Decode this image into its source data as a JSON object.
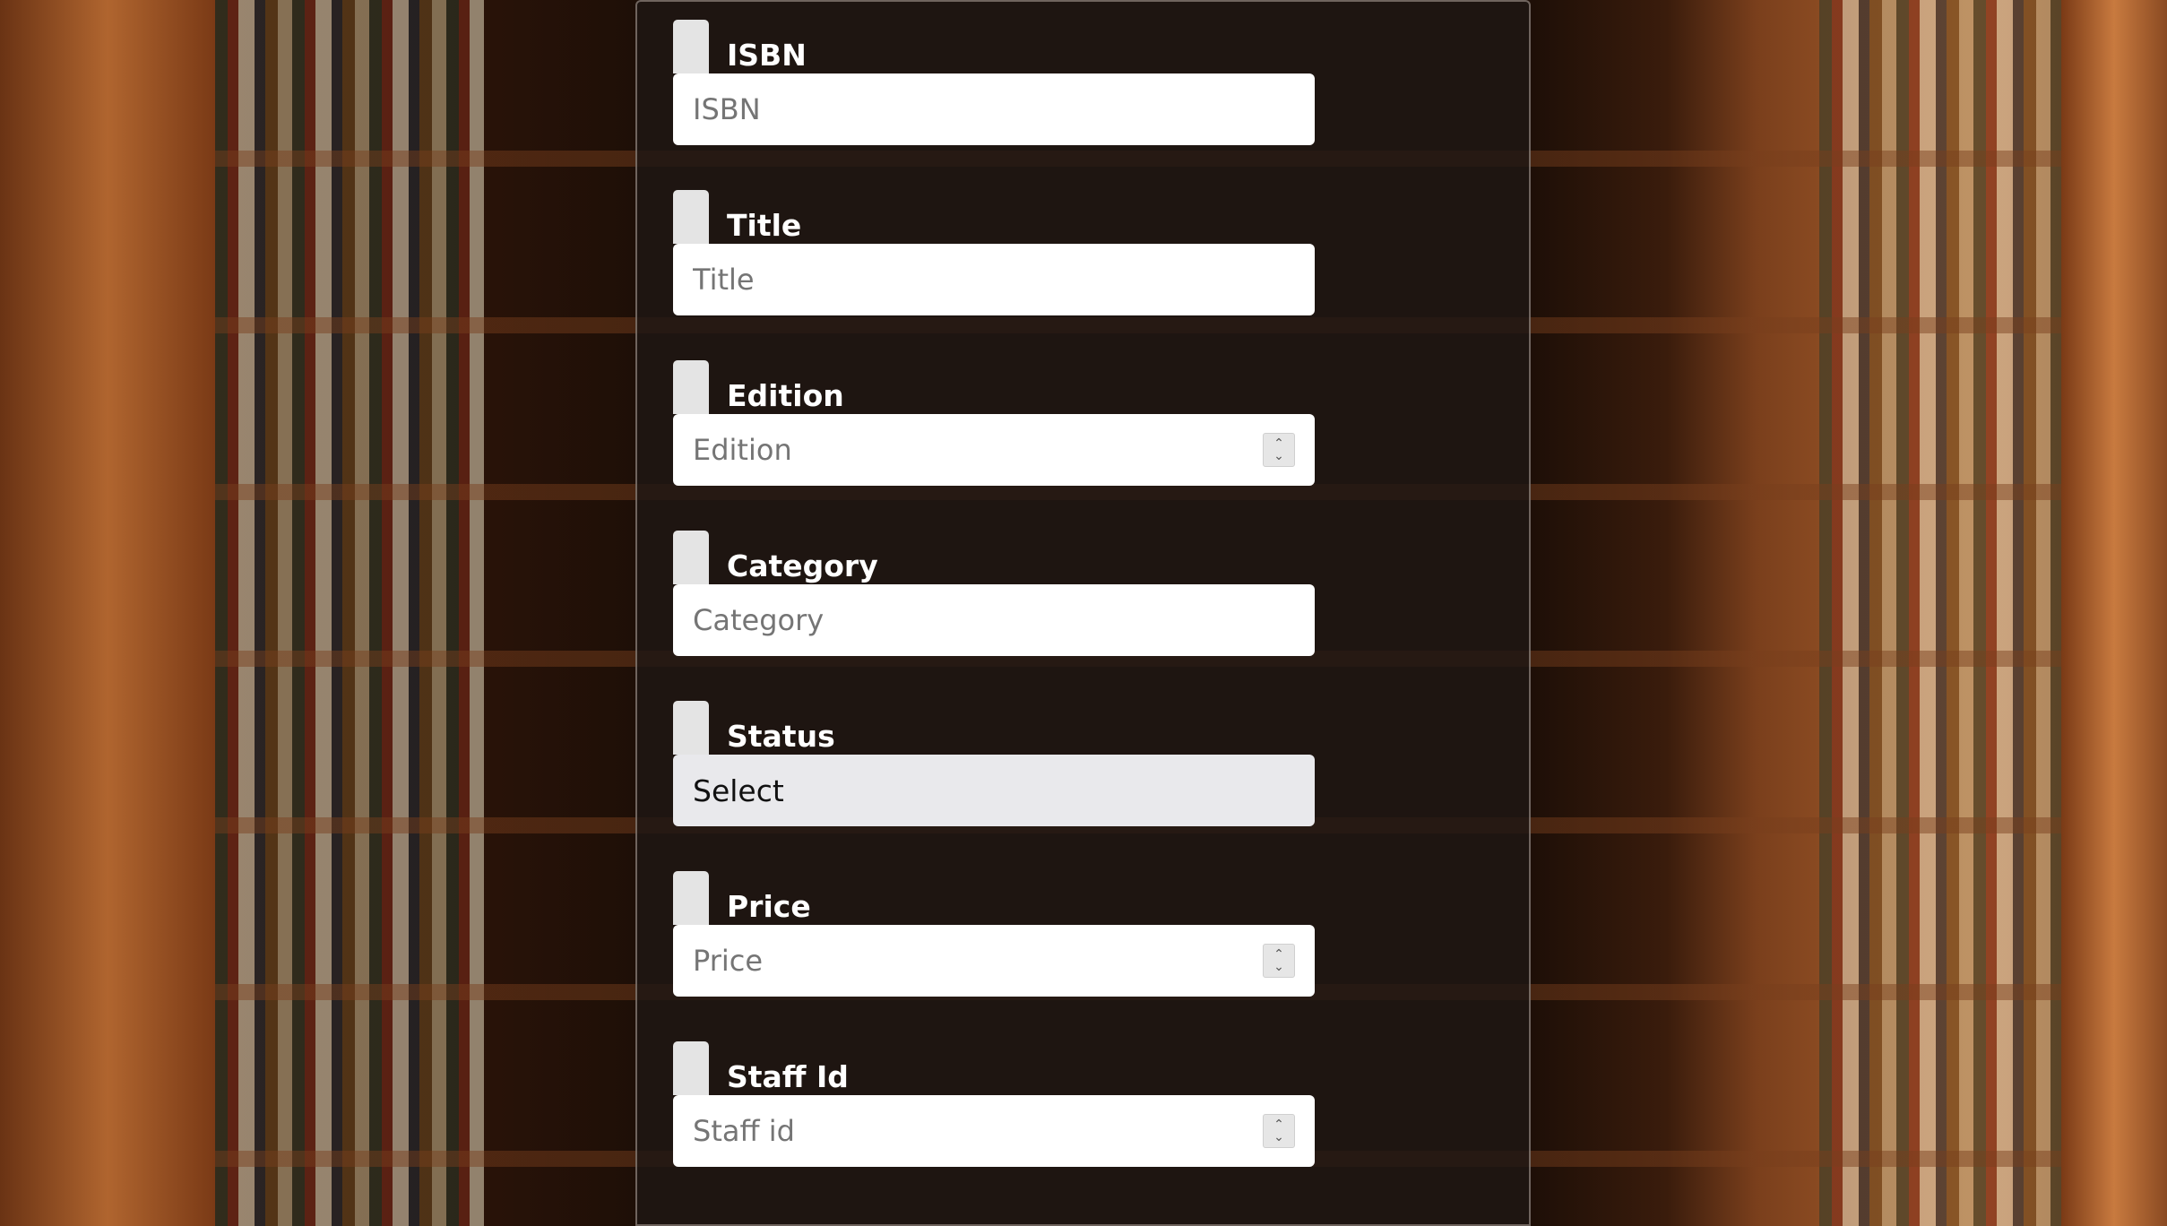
{
  "form": {
    "fields": [
      {
        "label": "ISBN",
        "placeholder": "ISBN",
        "type": "text"
      },
      {
        "label": "Title",
        "placeholder": "Title",
        "type": "text"
      },
      {
        "label": "Edition",
        "placeholder": "Edition",
        "type": "number"
      },
      {
        "label": "Category",
        "placeholder": "Category",
        "type": "text"
      },
      {
        "label": "Status",
        "selected": "Select",
        "type": "select"
      },
      {
        "label": "Price",
        "placeholder": "Price",
        "type": "number"
      },
      {
        "label": "Staff Id",
        "placeholder": "Staff id",
        "type": "number"
      }
    ]
  },
  "colors": {
    "panel_background": "#1e1614",
    "label_text": "#ffffff",
    "input_background": "#ffffff",
    "select_background": "#e9e9ec"
  }
}
